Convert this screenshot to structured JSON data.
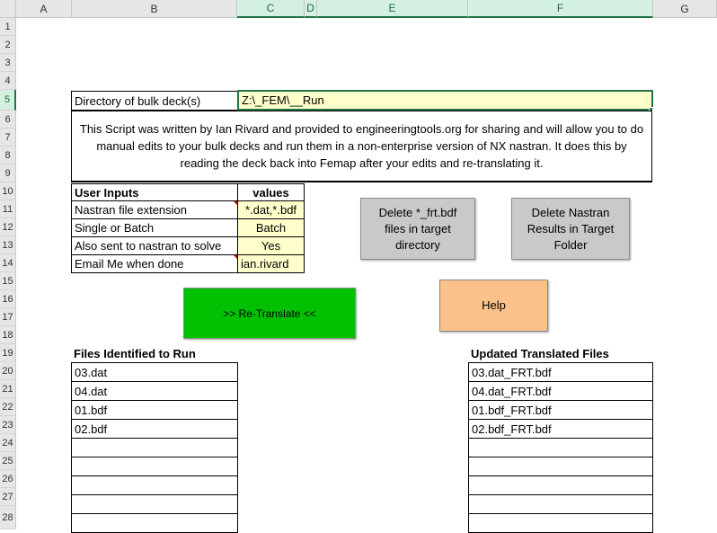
{
  "columns": [
    "A",
    "B",
    "C",
    "D",
    "E",
    "F",
    "G"
  ],
  "rows": [
    "1",
    "2",
    "3",
    "4",
    "5",
    "6",
    "7",
    "8",
    "9",
    "10",
    "11",
    "12",
    "13",
    "14",
    "15",
    "16",
    "17",
    "18",
    "19",
    "20",
    "21",
    "22",
    "23",
    "24",
    "25",
    "26",
    "27",
    "28"
  ],
  "directory": {
    "label": "Directory of bulk deck(s)",
    "value": "Z:\\_FEM\\__Run"
  },
  "description": "This Script was written by Ian Rivard and provided to engineeringtools.org for sharing and will allow you to do manual edits to your bulk decks and run them in a non-enterprise version of NX nastran. It does this by reading the deck back into Femap after your edits and re-translating it.",
  "inputs": {
    "header_label": "User Inputs",
    "header_values": "values",
    "items": [
      {
        "label": "Nastran file extension",
        "value": "*.dat,*.bdf"
      },
      {
        "label": "Single or Batch",
        "value": "Batch"
      },
      {
        "label": "Also sent to nastran to solve",
        "value": "Yes"
      },
      {
        "label": "Email Me when done",
        "value": "ian.rivard"
      }
    ]
  },
  "buttons": {
    "delete_frt": "Delete *_frt.bdf files in target directory",
    "delete_results": "Delete Nastran Results in Target Folder",
    "retranslate": ">> Re-Translate <<",
    "help": "Help"
  },
  "files_identified": {
    "title": "Files Identified to Run",
    "items": [
      "03.dat",
      "04.dat",
      "01.bdf",
      "02.bdf",
      "",
      "",
      "",
      "",
      ""
    ]
  },
  "updated_files": {
    "title": "Updated Translated Files",
    "items": [
      "03.dat_FRT.bdf",
      "04.dat_FRT.bdf",
      "01.bdf_FRT.bdf",
      "02.bdf_FRT.bdf",
      "",
      "",
      "",
      "",
      ""
    ]
  },
  "colors": {
    "input_fill": "#ffffcc",
    "retranslate_button": "#00c000",
    "help_button": "#fac18b",
    "delete_buttons": "#c9c9c9",
    "selection": "#217346"
  }
}
